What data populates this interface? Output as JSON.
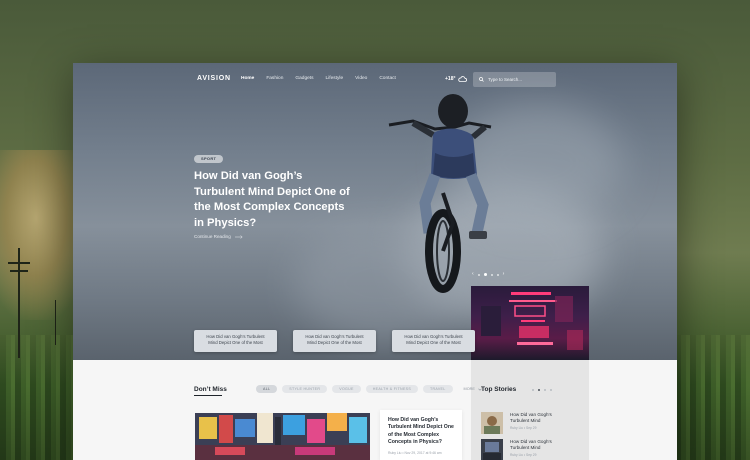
{
  "site": {
    "logo": "AVISION"
  },
  "nav": {
    "items": [
      {
        "label": "Home",
        "active": true
      },
      {
        "label": "Fashion"
      },
      {
        "label": "Gadgets"
      },
      {
        "label": "Lifestyle"
      },
      {
        "label": "Video"
      },
      {
        "label": "Contact"
      }
    ]
  },
  "weather": {
    "temperature": "+18°",
    "icon": "cloud-icon"
  },
  "search": {
    "placeholder": "Type to Search..."
  },
  "hero": {
    "tag": "SPORT",
    "title": "How Did van Gogh’s Turbulent Mind Depict One of the Most Complex Concepts in Physics?",
    "cta": "Continue Reading",
    "slides_total": 4,
    "slide_active": 2
  },
  "mini_cards": [
    {
      "line1": "How Did van Gogh’s Turbulent",
      "line2": "Mind Depict One of the Most"
    },
    {
      "line1": "How Did van Gogh’s Turbulent",
      "line2": "Mind Depict One of the Most"
    },
    {
      "line1": "How Did van Gogh’s Turbulent",
      "line2": "Mind Depict One of the Most"
    }
  ],
  "dont_miss": {
    "title": "Don’t Miss",
    "filters": [
      "ALL",
      "STYLE HUNTER",
      "VOGUE",
      "HEALTH & FITNESS",
      "TRAVEL"
    ],
    "active_filter": "ALL",
    "more": "MORE",
    "article": {
      "title": "How Did van Gogh’s Turbulent Mind Depict One of the Most Complex Concepts in Physics?",
      "meta": "Ruby Liu • Nov 29, 2017 at 9:46 am"
    }
  },
  "top_stories": {
    "title": "Top Stories",
    "items": [
      {
        "title": "How Did van Gogh’s Turbulent Mind",
        "meta": "Ruby Liu • Sep 29"
      },
      {
        "title": "How Did van Gogh’s Turbulent Mind",
        "meta": "Ruby Liu • Sep 29"
      }
    ]
  },
  "colors": {
    "hero_overlay": "#737f8d",
    "accent_pink": "#ff3c7a",
    "dark_text": "#1f242b"
  }
}
